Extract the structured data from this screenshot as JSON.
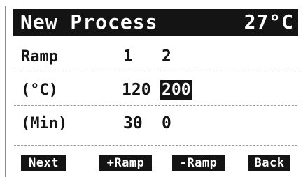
{
  "header": {
    "title": "New Process",
    "temperature": "27°C"
  },
  "rows": {
    "ramp": {
      "label": "Ramp",
      "values": [
        "1",
        "2"
      ]
    },
    "temp": {
      "label": "(°C)",
      "values": [
        "120",
        "200"
      ],
      "selected_index": 1
    },
    "time": {
      "label": "(Min)",
      "values": [
        "30",
        "0"
      ]
    }
  },
  "softkeys": {
    "next": "Next",
    "add_ramp": "+Ramp",
    "remove_ramp": "-Ramp",
    "back": "Back"
  },
  "colors": {
    "foreground": "#141414",
    "background": "#ffffff"
  }
}
